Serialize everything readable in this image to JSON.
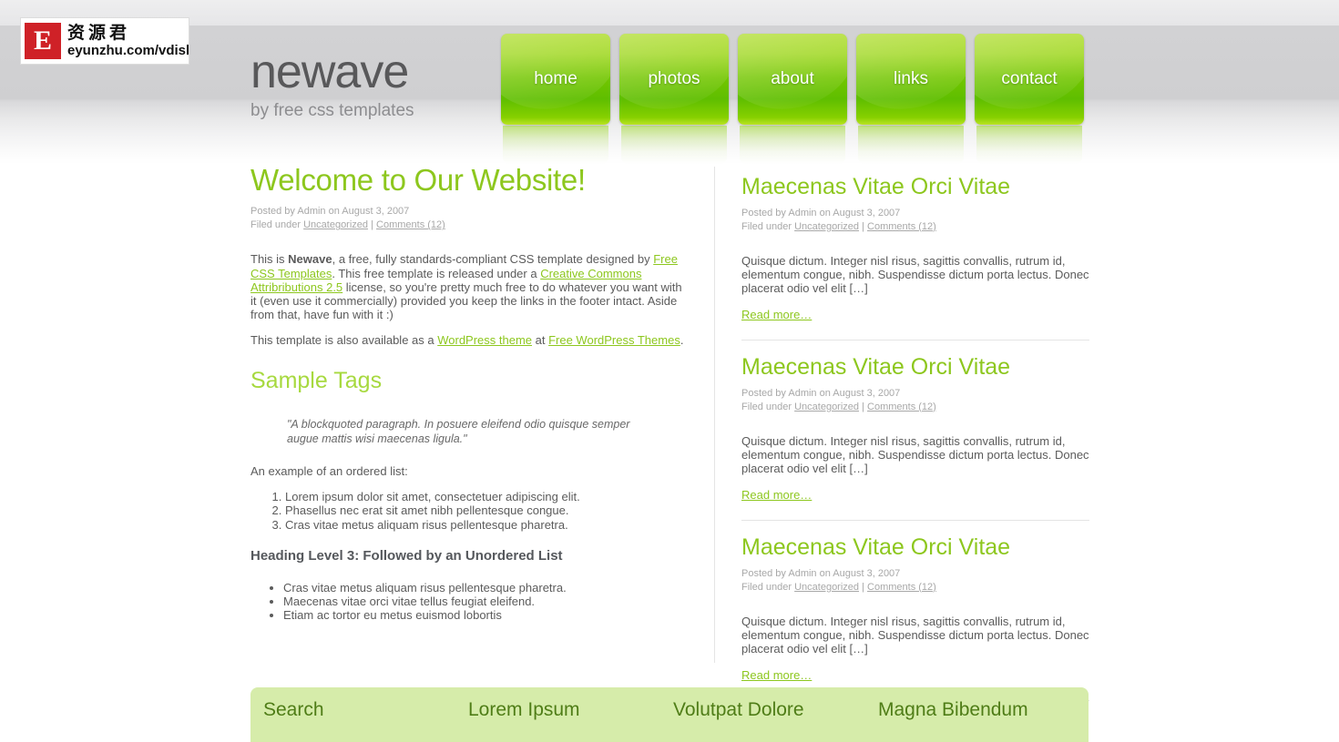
{
  "logo": {
    "mark_letter": "E",
    "chinese": "资源君",
    "url": "eyunzhu.com/vdisk"
  },
  "brand": {
    "name": "newave",
    "tagline": "by free css templates"
  },
  "nav": {
    "items": [
      {
        "label": "home"
      },
      {
        "label": "photos"
      },
      {
        "label": "about"
      },
      {
        "label": "links"
      },
      {
        "label": "contact"
      }
    ]
  },
  "main": {
    "post": {
      "title": "Welcome to Our Website!",
      "meta_posted": "Posted by Admin on August 3, 2007",
      "meta_filed_prefix": "Filed under ",
      "meta_category": "Uncategorized",
      "meta_separator": " | ",
      "meta_comments": "Comments (12)",
      "p1_a": "This is ",
      "p1_strong": "Newave",
      "p1_b": ", a free, fully standards-compliant CSS template designed by ",
      "p1_link1": "Free CSS Templates",
      "p1_c": ". This free template is released under a ",
      "p1_link2": "Creative Commons Attribributions 2.5",
      "p1_d": " license, so you're pretty much free to do whatever you want with it (even use it commercially) provided you keep the links in the footer intact. Aside from that, have fun with it :)",
      "p2_a": "This template is also available as a ",
      "p2_link1": "WordPress theme",
      "p2_b": " at ",
      "p2_link2": "Free WordPress Themes",
      "p2_c": "."
    },
    "sample_tags": {
      "heading": "Sample Tags",
      "blockquote": "\"A blockquoted paragraph. In posuere eleifend odio quisque semper augue mattis wisi maecenas ligula.\"",
      "ordered_intro": "An example of an ordered list:",
      "ordered_items": [
        "Lorem ipsum dolor sit amet, consectetuer adipiscing elit.",
        "Phasellus nec erat sit amet nibh pellentesque congue.",
        "Cras vitae metus aliquam risus pellentesque pharetra."
      ],
      "h3": "Heading Level 3: Followed by an Unordered List",
      "unordered_items": [
        "Cras vitae metus aliquam risus pellentesque pharetra.",
        "Maecenas vitae orci vitae tellus feugiat eleifend.",
        "Etiam ac tortor eu metus euismod lobortis"
      ]
    }
  },
  "sidebar": {
    "posts": [
      {
        "title": "Maecenas Vitae Orci Vitae",
        "meta_posted": "Posted by Admin on August 3, 2007",
        "meta_filed_prefix": "Filed under ",
        "meta_category": "Uncategorized",
        "meta_separator": " | ",
        "meta_comments": "Comments (12)",
        "excerpt": "Quisque dictum. Integer nisl risus, sagittis convallis, rutrum id, elementum congue, nibh. Suspendisse dictum porta lectus. Donec placerat odio vel elit […]",
        "read_more": "Read more…"
      },
      {
        "title": "Maecenas Vitae Orci Vitae",
        "meta_posted": "Posted by Admin on August 3, 2007",
        "meta_filed_prefix": "Filed under ",
        "meta_category": "Uncategorized",
        "meta_separator": " | ",
        "meta_comments": "Comments (12)",
        "excerpt": "Quisque dictum. Integer nisl risus, sagittis convallis, rutrum id, elementum congue, nibh. Suspendisse dictum porta lectus. Donec placerat odio vel elit […]",
        "read_more": "Read more…"
      },
      {
        "title": "Maecenas Vitae Orci Vitae",
        "meta_posted": "Posted by Admin on August 3, 2007",
        "meta_filed_prefix": "Filed under ",
        "meta_category": "Uncategorized",
        "meta_separator": " | ",
        "meta_comments": "Comments (12)",
        "excerpt": "Quisque dictum. Integer nisl risus, sagittis convallis, rutrum id, elementum congue, nibh. Suspendisse dictum porta lectus. Donec placerat odio vel elit […]",
        "read_more": "Read more…"
      }
    ]
  },
  "footer": {
    "columns": [
      {
        "heading": "Search"
      },
      {
        "heading": "Lorem Ipsum"
      },
      {
        "heading": "Volutpat Dolore"
      },
      {
        "heading": "Magna Bibendum"
      }
    ]
  },
  "colors": {
    "accent_green": "#8dc71e",
    "nav_green": "#73c600",
    "footer_green": "#d6ecaa",
    "footer_heading": "#4f7d17",
    "logo_red": "#cf2127",
    "brand_gray": "#58585a"
  }
}
